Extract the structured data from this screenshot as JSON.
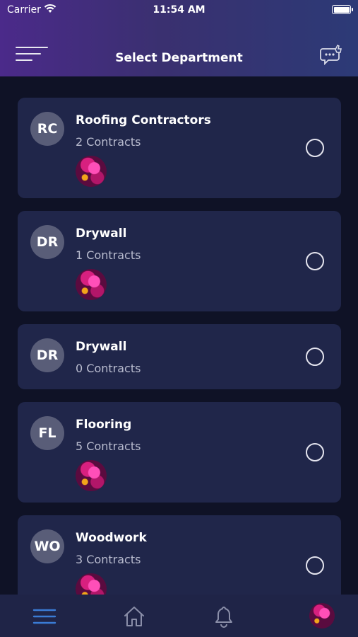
{
  "status_bar": {
    "carrier": "Carrier",
    "time": "11:54 AM"
  },
  "header": {
    "title": "Select Department",
    "menu_icon": "hamburger-menu-icon",
    "chat_icon": "chat-bubble-icon"
  },
  "departments": [
    {
      "initials": "RC",
      "name": "Roofing Contractors",
      "contracts": "2 Contracts",
      "has_thumb": true,
      "selected": false
    },
    {
      "initials": "DR",
      "name": "Drywall",
      "contracts": "1 Contracts",
      "has_thumb": true,
      "selected": false
    },
    {
      "initials": "DR",
      "name": "Drywall",
      "contracts": "0 Contracts",
      "has_thumb": false,
      "selected": false
    },
    {
      "initials": "FL",
      "name": "Flooring",
      "contracts": "5 Contracts",
      "has_thumb": true,
      "selected": false
    },
    {
      "initials": "WO",
      "name": "Woodwork",
      "contracts": "3 Contracts",
      "has_thumb": true,
      "selected": false
    }
  ],
  "tabbar": {
    "items": [
      "menu-icon",
      "home-icon",
      "bell-icon",
      "profile-avatar"
    ],
    "active_color": "#3a7bd5"
  }
}
